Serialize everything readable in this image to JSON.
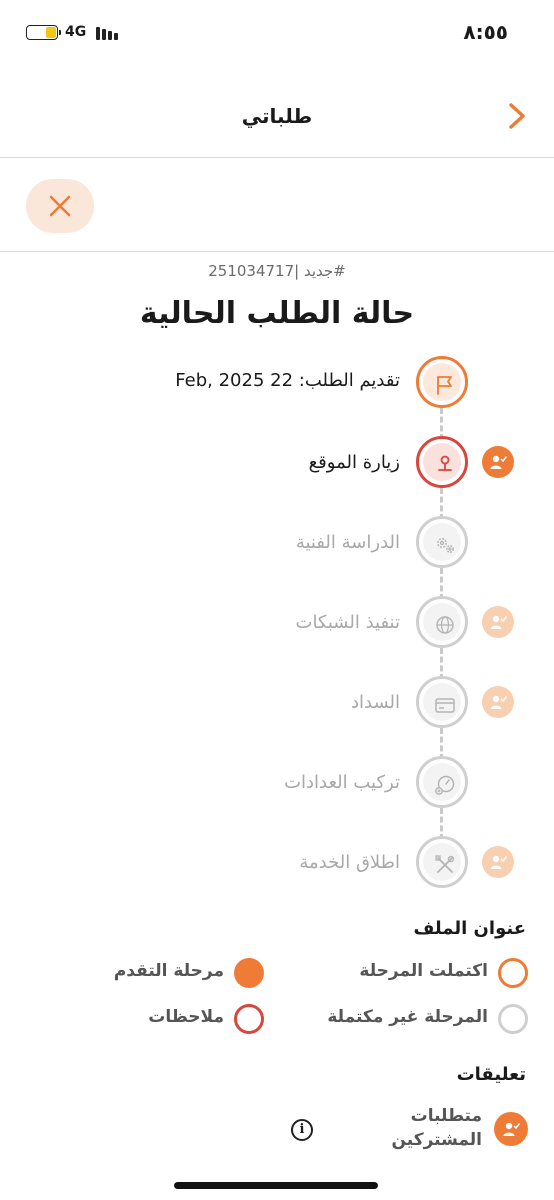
{
  "status_bar": {
    "time": "٨:٥٥",
    "network": "4G",
    "battery_color": "#f5c518"
  },
  "header": {
    "title": "طلباتي",
    "back_icon": "chevron-right-icon",
    "accent": "#ee7c36"
  },
  "action_bar": {
    "close_icon": "close-icon"
  },
  "order": {
    "number_line": "جديد |251034717#",
    "status_title": "حالة الطلب الحالية"
  },
  "timeline": {
    "steps": [
      {
        "label": "تقديم الطلب: 22 Feb, 2025",
        "state": "done",
        "icon": "flag-icon",
        "subscriber_badge": "none"
      },
      {
        "label": "زيارة الموقع",
        "state": "current",
        "icon": "location-pin-icon",
        "subscriber_badge": "active"
      },
      {
        "label": "الدراسة الفنية",
        "state": "pending",
        "icon": "gears-icon",
        "subscriber_badge": "none"
      },
      {
        "label": "تنفيذ الشبكات",
        "state": "pending",
        "icon": "globe-icon",
        "subscriber_badge": "faded"
      },
      {
        "label": "السداد",
        "state": "pending",
        "icon": "credit-card-icon",
        "subscriber_badge": "faded"
      },
      {
        "label": "تركيب العدادات",
        "state": "pending",
        "icon": "meter-gauge-icon",
        "subscriber_badge": "none"
      },
      {
        "label": "اطلاق الخدمة",
        "state": "pending",
        "icon": "tools-icon",
        "subscriber_badge": "faded"
      }
    ]
  },
  "legend": {
    "title": "عنوان الملف",
    "items": {
      "completed": "اكتملت المرحلة",
      "in_progress": "مرحلة التقدم",
      "incomplete": "المرحلة غير مكتملة",
      "notes": "ملاحظات"
    },
    "colors": {
      "orange": "#ee7c36",
      "red": "#d9463b",
      "gray": "#cfcfcf"
    }
  },
  "comments": {
    "title": "تعليقات",
    "item_label": "متطلبات المشتركين",
    "info_icon": "info-icon"
  }
}
